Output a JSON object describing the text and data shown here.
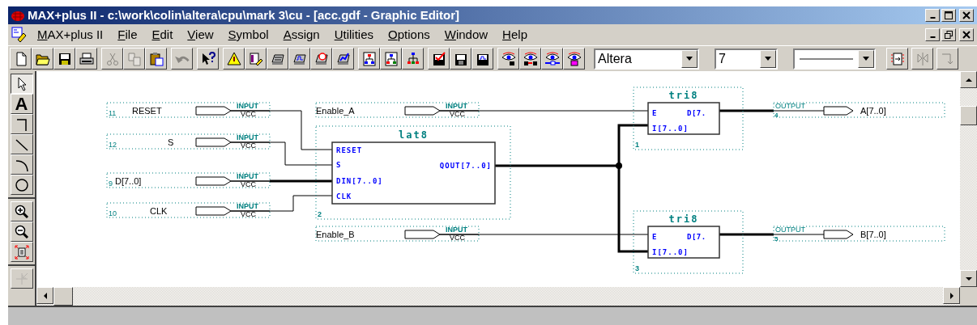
{
  "window": {
    "title": "MAX+plus II - c:\\work\\colin\\altera\\cpu\\mark 3\\cu - [acc.gdf - Graphic Editor]"
  },
  "menu": [
    "MAX+plus II",
    "File",
    "Edit",
    "View",
    "Symbol",
    "Assign",
    "Utilities",
    "Options",
    "Window",
    "Help"
  ],
  "toolbar_groups": [
    [
      {
        "kind": "new",
        "disabled": false
      },
      {
        "kind": "open",
        "disabled": false
      },
      {
        "kind": "save",
        "disabled": false
      },
      {
        "kind": "print",
        "disabled": false
      }
    ],
    [
      {
        "kind": "cut",
        "disabled": true
      },
      {
        "kind": "copy",
        "disabled": true
      },
      {
        "kind": "paste",
        "disabled": false
      }
    ],
    [
      {
        "kind": "undo",
        "disabled": true
      }
    ],
    [
      {
        "kind": "help",
        "disabled": false
      }
    ],
    [
      {
        "kind": "warning",
        "disabled": false
      },
      {
        "kind": "symbol",
        "disabled": false
      },
      {
        "kind": "device",
        "disabled": false
      },
      {
        "kind": "waveform",
        "disabled": false
      },
      {
        "kind": "timer",
        "disabled": false
      },
      {
        "kind": "chart",
        "disabled": false
      }
    ],
    [
      {
        "kind": "hier-up",
        "disabled": false
      },
      {
        "kind": "hier-down",
        "disabled": false
      },
      {
        "kind": "hier-tree",
        "disabled": false
      }
    ],
    [
      {
        "kind": "check-disk",
        "disabled": false
      },
      {
        "kind": "chip-disk",
        "disabled": false
      },
      {
        "kind": "wave-disk",
        "disabled": false
      }
    ],
    [
      {
        "kind": "eye-text",
        "disabled": false
      },
      {
        "kind": "eye-swap",
        "disabled": false
      },
      {
        "kind": "eye-wire",
        "disabled": false
      },
      {
        "kind": "eye-node",
        "disabled": false
      }
    ]
  ],
  "font": {
    "value": "Altera"
  },
  "size": {
    "value": "7"
  },
  "right_tools": [
    {
      "kind": "frame",
      "disabled": false
    },
    {
      "kind": "flip",
      "disabled": true
    },
    {
      "kind": "rotate",
      "disabled": true
    }
  ],
  "tools": [
    {
      "kind": "pointer",
      "selected": true,
      "disabled": false
    },
    {
      "glyph": "A",
      "selected": false,
      "disabled": false
    },
    {
      "kind": "ortho-line",
      "selected": false,
      "disabled": false
    },
    {
      "kind": "line",
      "selected": false,
      "disabled": false
    },
    {
      "kind": "arc",
      "selected": false,
      "disabled": false
    },
    {
      "kind": "circle",
      "selected": false,
      "disabled": false
    },
    {
      "kind": "zoom-in",
      "selected": false,
      "disabled": false
    },
    {
      "kind": "zoom-out",
      "selected": false,
      "disabled": false
    },
    {
      "kind": "fit",
      "selected": false,
      "disabled": false
    },
    {
      "kind": "rubberband",
      "selected": false,
      "disabled": true
    }
  ],
  "schematic": {
    "input_pins": [
      {
        "number": "11",
        "name": "RESET",
        "type": "INPUT",
        "default": "VCC"
      },
      {
        "number": "12",
        "name": "S",
        "type": "INPUT",
        "default": "VCC"
      },
      {
        "number": "9",
        "name": "D[7..0]",
        "type": "INPUT",
        "default": "VCC"
      },
      {
        "number": "10",
        "name": "CLK",
        "type": "INPUT",
        "default": "VCC"
      },
      {
        "name": "Enable_A",
        "type": "INPUT",
        "default": "VCC"
      },
      {
        "name": "Enable_B",
        "type": "INPUT",
        "default": "VCC"
      }
    ],
    "symbols": [
      {
        "name": "lat8",
        "instance": "2",
        "left_ports": [
          "RESET",
          "S",
          "DIN[7..0]",
          "CLK"
        ],
        "right_ports": [
          "QOUT[7..0]"
        ]
      },
      {
        "name": "tri8",
        "instance": "1",
        "left_ports": [
          "E",
          "I[7..0]"
        ],
        "right_ports": [
          "D[7."
        ]
      },
      {
        "name": "tri8",
        "instance": "3",
        "left_ports": [
          "E",
          "I[7..0]"
        ],
        "right_ports": [
          "D[7."
        ]
      }
    ],
    "output_pins": [
      {
        "type": "OUTPUT",
        "number": "4",
        "name": "A[7..0]"
      },
      {
        "type": "OUTPUT",
        "number": "5",
        "name": "B[7..0]"
      }
    ]
  }
}
